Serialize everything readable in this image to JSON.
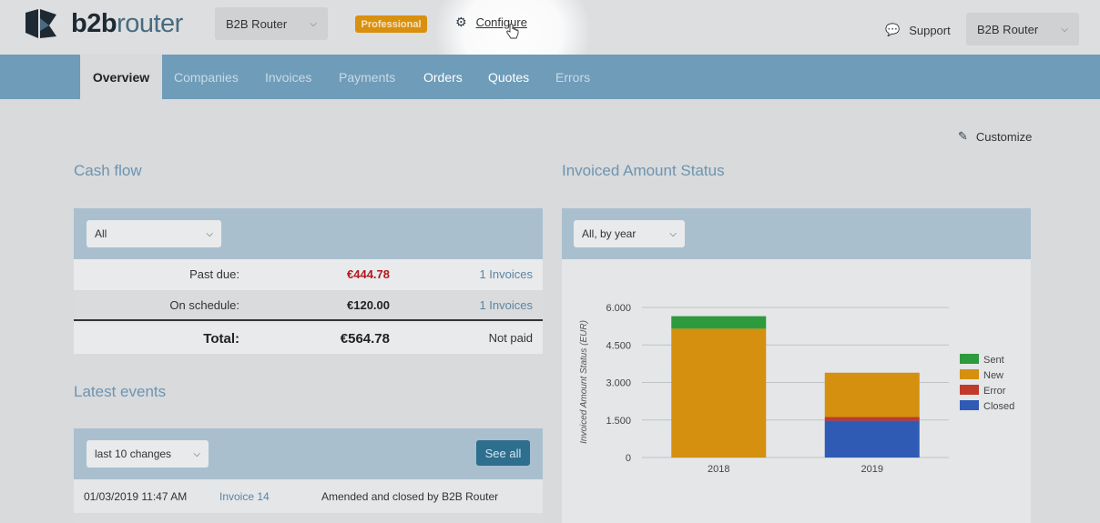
{
  "header": {
    "logo_text_bold": "b2b",
    "logo_text_light": "router",
    "org_select": "B2B Router",
    "plan_badge": "Professional",
    "configure_label": "Configure",
    "support_label": "Support",
    "account_select": "B2B Router"
  },
  "nav": {
    "tabs": [
      {
        "label": "Overview"
      },
      {
        "label": "Companies"
      },
      {
        "label": "Invoices"
      },
      {
        "label": "Payments"
      },
      {
        "label": "Orders"
      },
      {
        "label": "Quotes"
      },
      {
        "label": "Errors"
      }
    ]
  },
  "customize_label": "Customize",
  "cash_flow": {
    "title": "Cash flow",
    "filter": "All",
    "rows": [
      {
        "label": "Past due:",
        "amount": "€444.78",
        "invoices": "1 Invoices"
      },
      {
        "label": "On schedule:",
        "amount": "€120.00",
        "invoices": "1 Invoices"
      },
      {
        "label": "Total:",
        "amount": "€564.78",
        "status": "Not paid"
      }
    ]
  },
  "latest_events": {
    "title": "Latest events",
    "filter": "last 10 changes",
    "see_all": "See all",
    "rows": [
      {
        "date": "01/03/2019 11:47 AM",
        "doc": "Invoice 14",
        "action": "Amended and closed by B2B Router"
      }
    ]
  },
  "invoiced_status": {
    "title": "Invoiced Amount Status",
    "filter": "All, by year"
  },
  "colors": {
    "accent_nav": "#6f9cb9",
    "sent": "#2e9a3e",
    "new": "#d4900e",
    "error": "#c0392b",
    "closed": "#2f5bb5",
    "past_due": "#b3161e"
  },
  "chart_data": {
    "type": "bar",
    "stacked": true,
    "title": "",
    "xlabel": "",
    "ylabel": "Invoiced Amount Status (EUR)",
    "categories": [
      "2018",
      "2019"
    ],
    "ylim": [
      0,
      6000
    ],
    "yticks": [
      0,
      1500,
      3000,
      4500,
      6000
    ],
    "ytick_labels": [
      "0",
      "1.500",
      "3.000",
      "4.500",
      "6.000"
    ],
    "grid": true,
    "legend": "right",
    "series": [
      {
        "name": "Closed",
        "color": "#2f5bb5",
        "values": [
          0,
          1470
        ]
      },
      {
        "name": "Error",
        "color": "#c0392b",
        "values": [
          0,
          150
        ]
      },
      {
        "name": "New",
        "color": "#d4900e",
        "values": [
          5150,
          1770
        ]
      },
      {
        "name": "Sent",
        "color": "#2e9a3e",
        "values": [
          500,
          0
        ]
      }
    ],
    "legend_order": [
      "Sent",
      "New",
      "Error",
      "Closed"
    ]
  }
}
